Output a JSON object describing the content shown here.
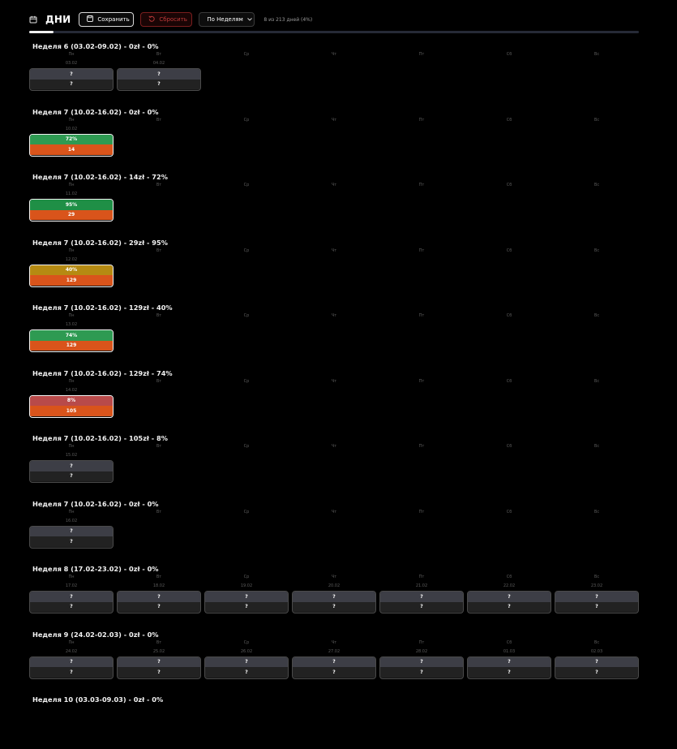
{
  "header": {
    "title": "ДНИ",
    "save_label": "Сохранить",
    "reset_label": "Сбросить",
    "select_value": "По Неделям",
    "days_info": "8 из 213 дней (4%)",
    "progress_fraction": 0.04
  },
  "weeks": [
    {
      "title": "Неделя 6 (03.02-09.02) - 0zł - 0%",
      "days": [
        "Пн",
        "Вт",
        "Ср",
        "Чт",
        "Пт",
        "Сб",
        "Вс"
      ],
      "dates": [
        "03.02",
        "04.02",
        "",
        "",
        "",
        "",
        ""
      ],
      "cards": [
        {
          "top": "?",
          "bottom": "?",
          "color": ""
        },
        {
          "top": "?",
          "bottom": "?",
          "color": ""
        }
      ]
    },
    {
      "title": "Неделя 7 (10.02-16.02) - 0zł - 0%",
      "days": [
        "Пн",
        "Вт",
        "Ср",
        "Чт",
        "Пт",
        "Сб",
        "Вс"
      ],
      "dates": [
        "10.02",
        "",
        "",
        "",
        "",
        "",
        ""
      ],
      "cards": [
        {
          "top": "72%",
          "bottom": "14",
          "color": "#2e9a52"
        }
      ]
    },
    {
      "title": "Неделя 7 (10.02-16.02) - 14zł - 72%",
      "days": [
        "Пн",
        "Вт",
        "Ср",
        "Чт",
        "Пт",
        "Сб",
        "Вс"
      ],
      "dates": [
        "11.02",
        "",
        "",
        "",
        "",
        "",
        ""
      ],
      "cards": [
        {
          "top": "95%",
          "bottom": "29",
          "color": "#1f8f46"
        }
      ]
    },
    {
      "title": "Неделя 7 (10.02-16.02) - 29zł - 95%",
      "days": [
        "Пн",
        "Вт",
        "Ср",
        "Чт",
        "Пт",
        "Сб",
        "Вс"
      ],
      "dates": [
        "12.02",
        "",
        "",
        "",
        "",
        "",
        ""
      ],
      "cards": [
        {
          "top": "40%",
          "bottom": "129",
          "color": "#b58a12"
        }
      ]
    },
    {
      "title": "Неделя 7 (10.02-16.02) - 129zł - 40%",
      "days": [
        "Пн",
        "Вт",
        "Ср",
        "Чт",
        "Пт",
        "Сб",
        "Вс"
      ],
      "dates": [
        "13.02",
        "",
        "",
        "",
        "",
        "",
        ""
      ],
      "cards": [
        {
          "top": "74%",
          "bottom": "129",
          "color": "#2e9a52"
        }
      ]
    },
    {
      "title": "Неделя 7 (10.02-16.02) - 129zł - 74%",
      "days": [
        "Пн",
        "Вт",
        "Ср",
        "Чт",
        "Пт",
        "Сб",
        "Вс"
      ],
      "dates": [
        "14.02",
        "",
        "",
        "",
        "",
        "",
        ""
      ],
      "cards": [
        {
          "top": "8%",
          "bottom": "105",
          "color": "#b84a4a"
        }
      ]
    },
    {
      "title": "Неделя 7 (10.02-16.02) - 105zł - 8%",
      "days": [
        "Пн",
        "Вт",
        "Ср",
        "Чт",
        "Пт",
        "Сб",
        "Вс"
      ],
      "dates": [
        "15.02",
        "",
        "",
        "",
        "",
        "",
        ""
      ],
      "cards": [
        {
          "top": "?",
          "bottom": "?",
          "color": ""
        }
      ]
    },
    {
      "title": "Неделя 7 (10.02-16.02) - 0zł - 0%",
      "days": [
        "Пн",
        "Вт",
        "Ср",
        "Чт",
        "Пт",
        "Сб",
        "Вс"
      ],
      "dates": [
        "16.02",
        "",
        "",
        "",
        "",
        "",
        ""
      ],
      "cards": [
        {
          "top": "?",
          "bottom": "?",
          "color": ""
        }
      ]
    },
    {
      "title": "Неделя 8 (17.02-23.02) - 0zł - 0%",
      "days": [
        "Пн",
        "Вт",
        "Ср",
        "Чт",
        "Пт",
        "Сб",
        "Вс"
      ],
      "dates": [
        "17.02",
        "18.02",
        "19.02",
        "20.02",
        "21.02",
        "22.02",
        "23.02"
      ],
      "cards": [
        {
          "top": "?",
          "bottom": "?",
          "color": ""
        },
        {
          "top": "?",
          "bottom": "?",
          "color": ""
        },
        {
          "top": "?",
          "bottom": "?",
          "color": ""
        },
        {
          "top": "?",
          "bottom": "?",
          "color": ""
        },
        {
          "top": "?",
          "bottom": "?",
          "color": ""
        },
        {
          "top": "?",
          "bottom": "?",
          "color": ""
        },
        {
          "top": "?",
          "bottom": "?",
          "color": ""
        }
      ]
    },
    {
      "title": "Неделя 9 (24.02-02.03) - 0zł - 0%",
      "days": [
        "Пн",
        "Вт",
        "Ср",
        "Чт",
        "Пт",
        "Сб",
        "Вс"
      ],
      "dates": [
        "24.02",
        "25.02",
        "26.02",
        "27.02",
        "28.02",
        "01.03",
        "02.03"
      ],
      "cards": [
        {
          "top": "?",
          "bottom": "?",
          "color": ""
        },
        {
          "top": "?",
          "bottom": "?",
          "color": ""
        },
        {
          "top": "?",
          "bottom": "?",
          "color": ""
        },
        {
          "top": "?",
          "bottom": "?",
          "color": ""
        },
        {
          "top": "?",
          "bottom": "?",
          "color": ""
        },
        {
          "top": "?",
          "bottom": "?",
          "color": ""
        },
        {
          "top": "?",
          "bottom": "?",
          "color": ""
        }
      ]
    },
    {
      "title": "Неделя 10 (03.03-09.03) - 0zł - 0%",
      "days": [],
      "dates": [],
      "cards": []
    }
  ]
}
